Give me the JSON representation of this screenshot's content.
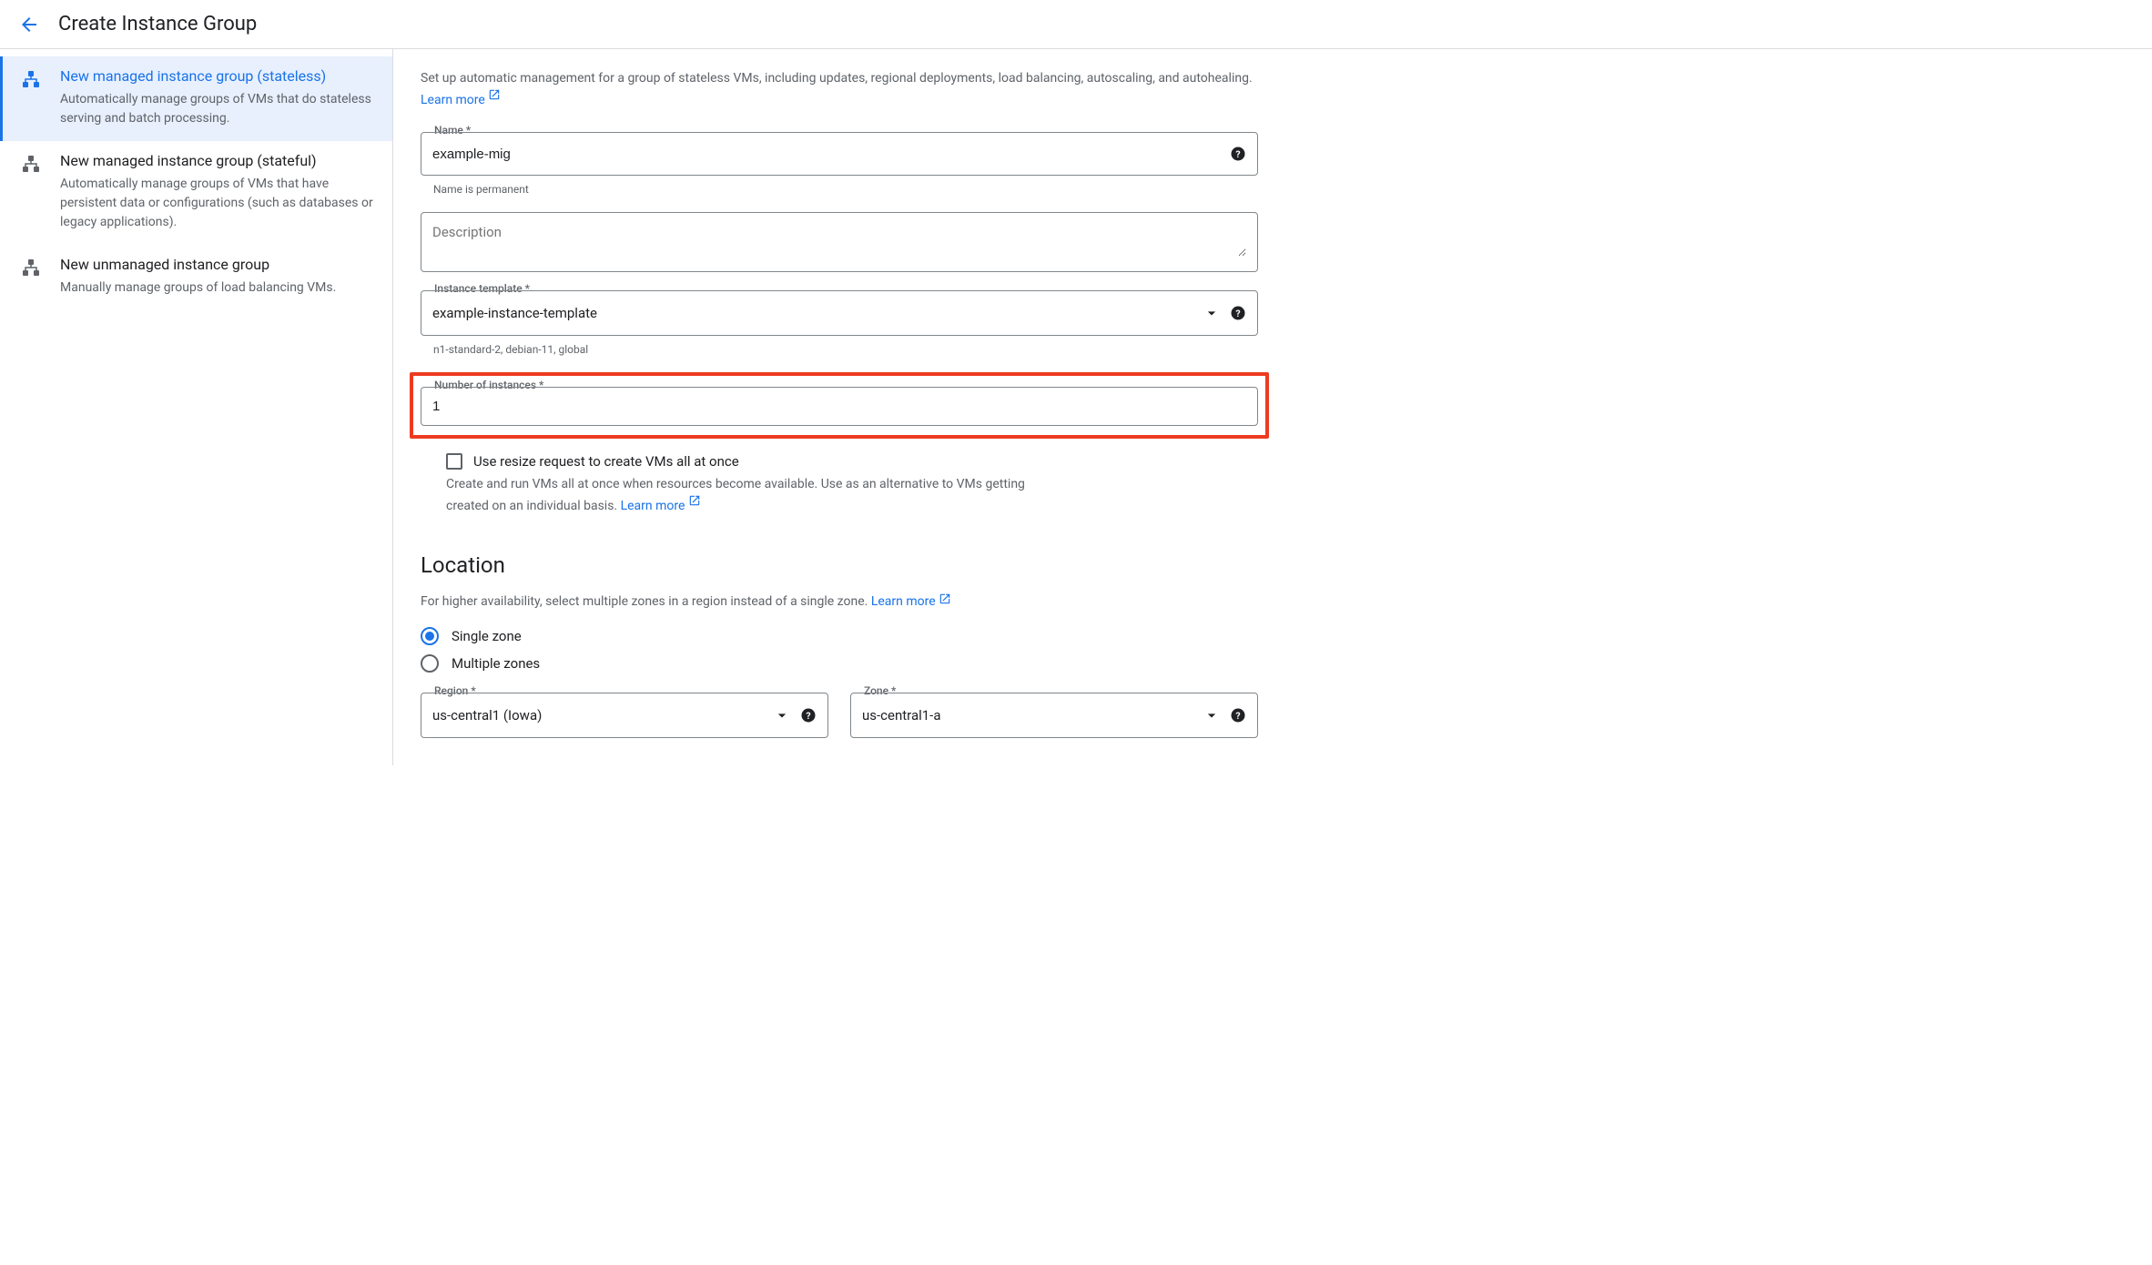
{
  "header": {
    "title": "Create Instance Group"
  },
  "sidebar": {
    "items": [
      {
        "title": "New managed instance group (stateless)",
        "desc": "Automatically manage groups of VMs that do stateless serving and batch processing."
      },
      {
        "title": "New managed instance group (stateful)",
        "desc": "Automatically manage groups of VMs that have persistent data or configurations (such as databases or legacy applications)."
      },
      {
        "title": "New unmanaged instance group",
        "desc": "Manually manage groups of load balancing VMs."
      }
    ]
  },
  "intro": {
    "text": "Set up automatic management for a group of stateless VMs, including updates, regional deployments, load balancing, autoscaling, and autohealing. ",
    "learn_more": "Learn more"
  },
  "fields": {
    "name": {
      "label": "Name *",
      "value": "example-mig",
      "help": "Name is permanent"
    },
    "description": {
      "placeholder": "Description"
    },
    "template": {
      "label": "Instance template *",
      "value": "example-instance-template",
      "help": "n1-standard-2, debian-11, global"
    },
    "instances": {
      "label": "Number of instances *",
      "value": "1"
    },
    "resize": {
      "label": "Use resize request to create VMs all at once",
      "desc": "Create and run VMs all at once when resources become available. Use as an alternative to VMs getting created on an individual basis. ",
      "learn_more": "Learn more"
    }
  },
  "location": {
    "title": "Location",
    "desc": "For higher availability, select multiple zones in a region instead of a single zone. ",
    "learn_more": "Learn more",
    "options": [
      {
        "label": "Single zone",
        "checked": true
      },
      {
        "label": "Multiple zones",
        "checked": false
      }
    ],
    "region": {
      "label": "Region *",
      "value": "us-central1 (Iowa)"
    },
    "zone": {
      "label": "Zone *",
      "value": "us-central1-a"
    }
  }
}
